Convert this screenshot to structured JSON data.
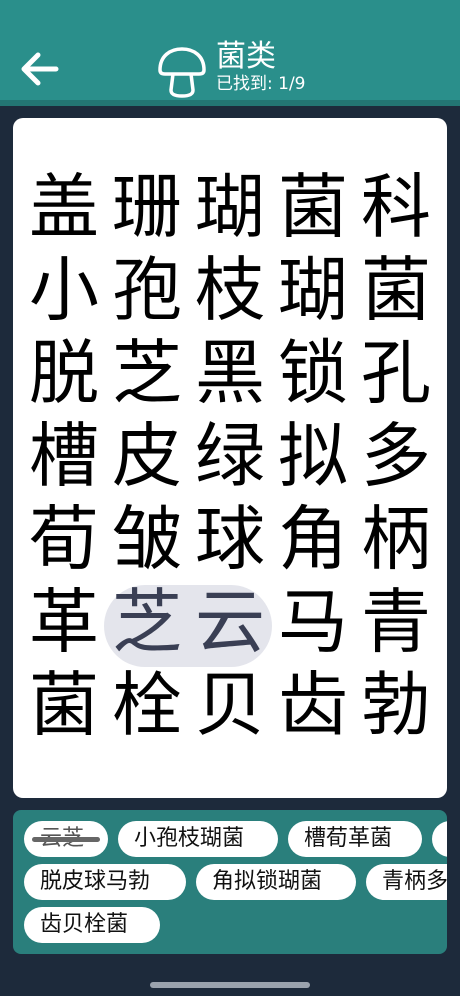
{
  "header": {
    "title": "菌类",
    "progress": "已找到: 1/9",
    "back_icon": "arrow-left-icon",
    "category_icon": "mushroom-icon",
    "bg_color": "#2a8f8b"
  },
  "grid": [
    [
      "盖",
      "珊",
      "瑚",
      "菌",
      "科"
    ],
    [
      "小",
      "孢",
      "枝",
      "瑚",
      "菌"
    ],
    [
      "脱",
      "芝",
      "黑",
      "锁",
      "孔"
    ],
    [
      "槽",
      "皮",
      "绿",
      "拟",
      "多"
    ],
    [
      "荀",
      "皱",
      "球",
      "角",
      "柄"
    ],
    [
      "革",
      "芝",
      "云",
      "马",
      "青"
    ],
    [
      "菌",
      "栓",
      "贝",
      "齿",
      "勃"
    ]
  ],
  "found_word": "芝云",
  "words": [
    {
      "text": "云芝",
      "found": true
    },
    {
      "text": "小孢枝瑚菌",
      "found": false
    },
    {
      "text": "槽荀革菌",
      "found": false
    },
    {
      "text": "",
      "found": false
    },
    {
      "text": "脱皮球马勃",
      "found": false
    },
    {
      "text": "角拟锁瑚菌",
      "found": false
    },
    {
      "text": "青柄多",
      "found": false
    },
    {
      "text": "齿贝栓菌",
      "found": false
    }
  ]
}
